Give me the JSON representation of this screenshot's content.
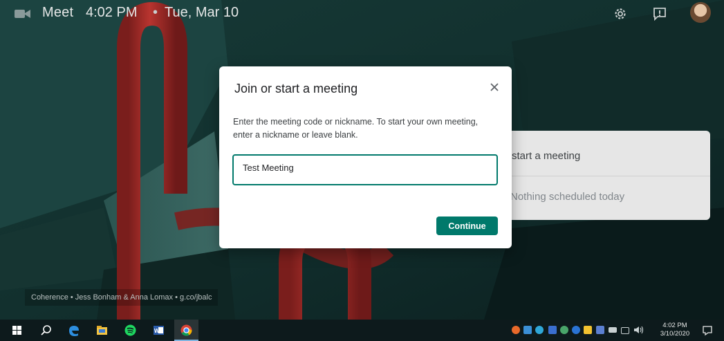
{
  "header": {
    "app_name": "Meet",
    "time": "4:02 PM",
    "separator": "•",
    "date": "Tue, Mar 10"
  },
  "side_card": {
    "start_label": "start a meeting",
    "empty_label": "Nothing scheduled today"
  },
  "dialog": {
    "title": "Join or start a meeting",
    "description": "Enter the meeting code or nickname. To start your own meeting, enter a nickname or leave blank.",
    "input_value": "Test Meeting",
    "continue_label": "Continue",
    "accent": "#00796b"
  },
  "background_caption": "Coherence • Jess Bonham & Anna Lomax • g.co/jbalc",
  "taskbar": {
    "pinned": [
      "windows-start-icon",
      "search-icon",
      "edge-icon",
      "file-explorer-icon",
      "spotify-icon",
      "word-icon",
      "chrome-icon"
    ],
    "clock_time": "4:02 PM",
    "clock_date": "3/10/2020"
  },
  "colors": {
    "teal_accent": "#00796b",
    "background": "#0f2a28",
    "sculpture_red": "#a82d2a"
  }
}
